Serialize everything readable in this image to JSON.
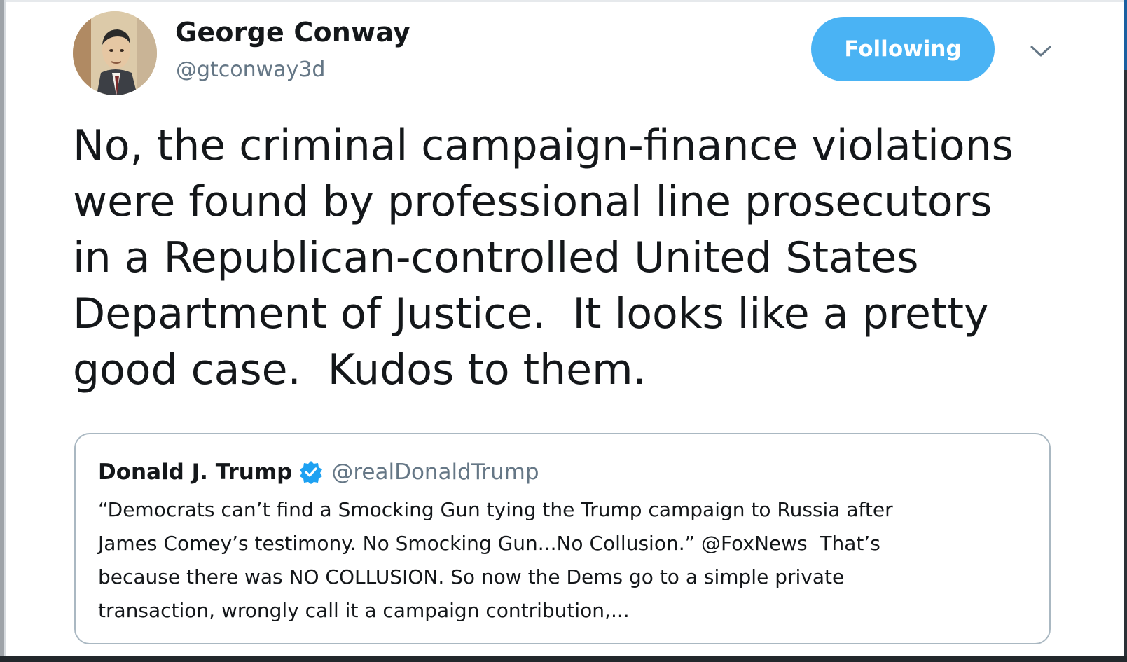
{
  "author": {
    "name": "George Conway",
    "handle": "@gtconway3d"
  },
  "follow_button": {
    "label": "Following",
    "color": "#4ab3f4"
  },
  "menu": {
    "icon": "chevron-down-icon"
  },
  "tweet": {
    "lines": [
      "No, the criminal campaign-finance violations",
      "were found by professional line prosecutors",
      "in a Republican-controlled United States",
      "Department of Justice.  It looks like a pretty",
      "good case.  Kudos to them."
    ]
  },
  "quoted_tweet": {
    "name": "Donald J. Trump",
    "verified_icon": "verified-badge-icon",
    "handle": "@realDonaldTrump",
    "lines": [
      "“Democrats can’t find a Smocking Gun tying the Trump campaign to Russia after",
      "James Comey’s testimony. No Smocking Gun...No Collusion.” @FoxNews  That’s",
      "because there was NO COLLUSION. So now the Dems go to a simple private",
      "transaction, wrongly call it a campaign contribution,..."
    ]
  },
  "colors": {
    "text": "#14171a",
    "secondary": "#657786",
    "accent": "#1da1f2",
    "border": "#aab8c2"
  }
}
